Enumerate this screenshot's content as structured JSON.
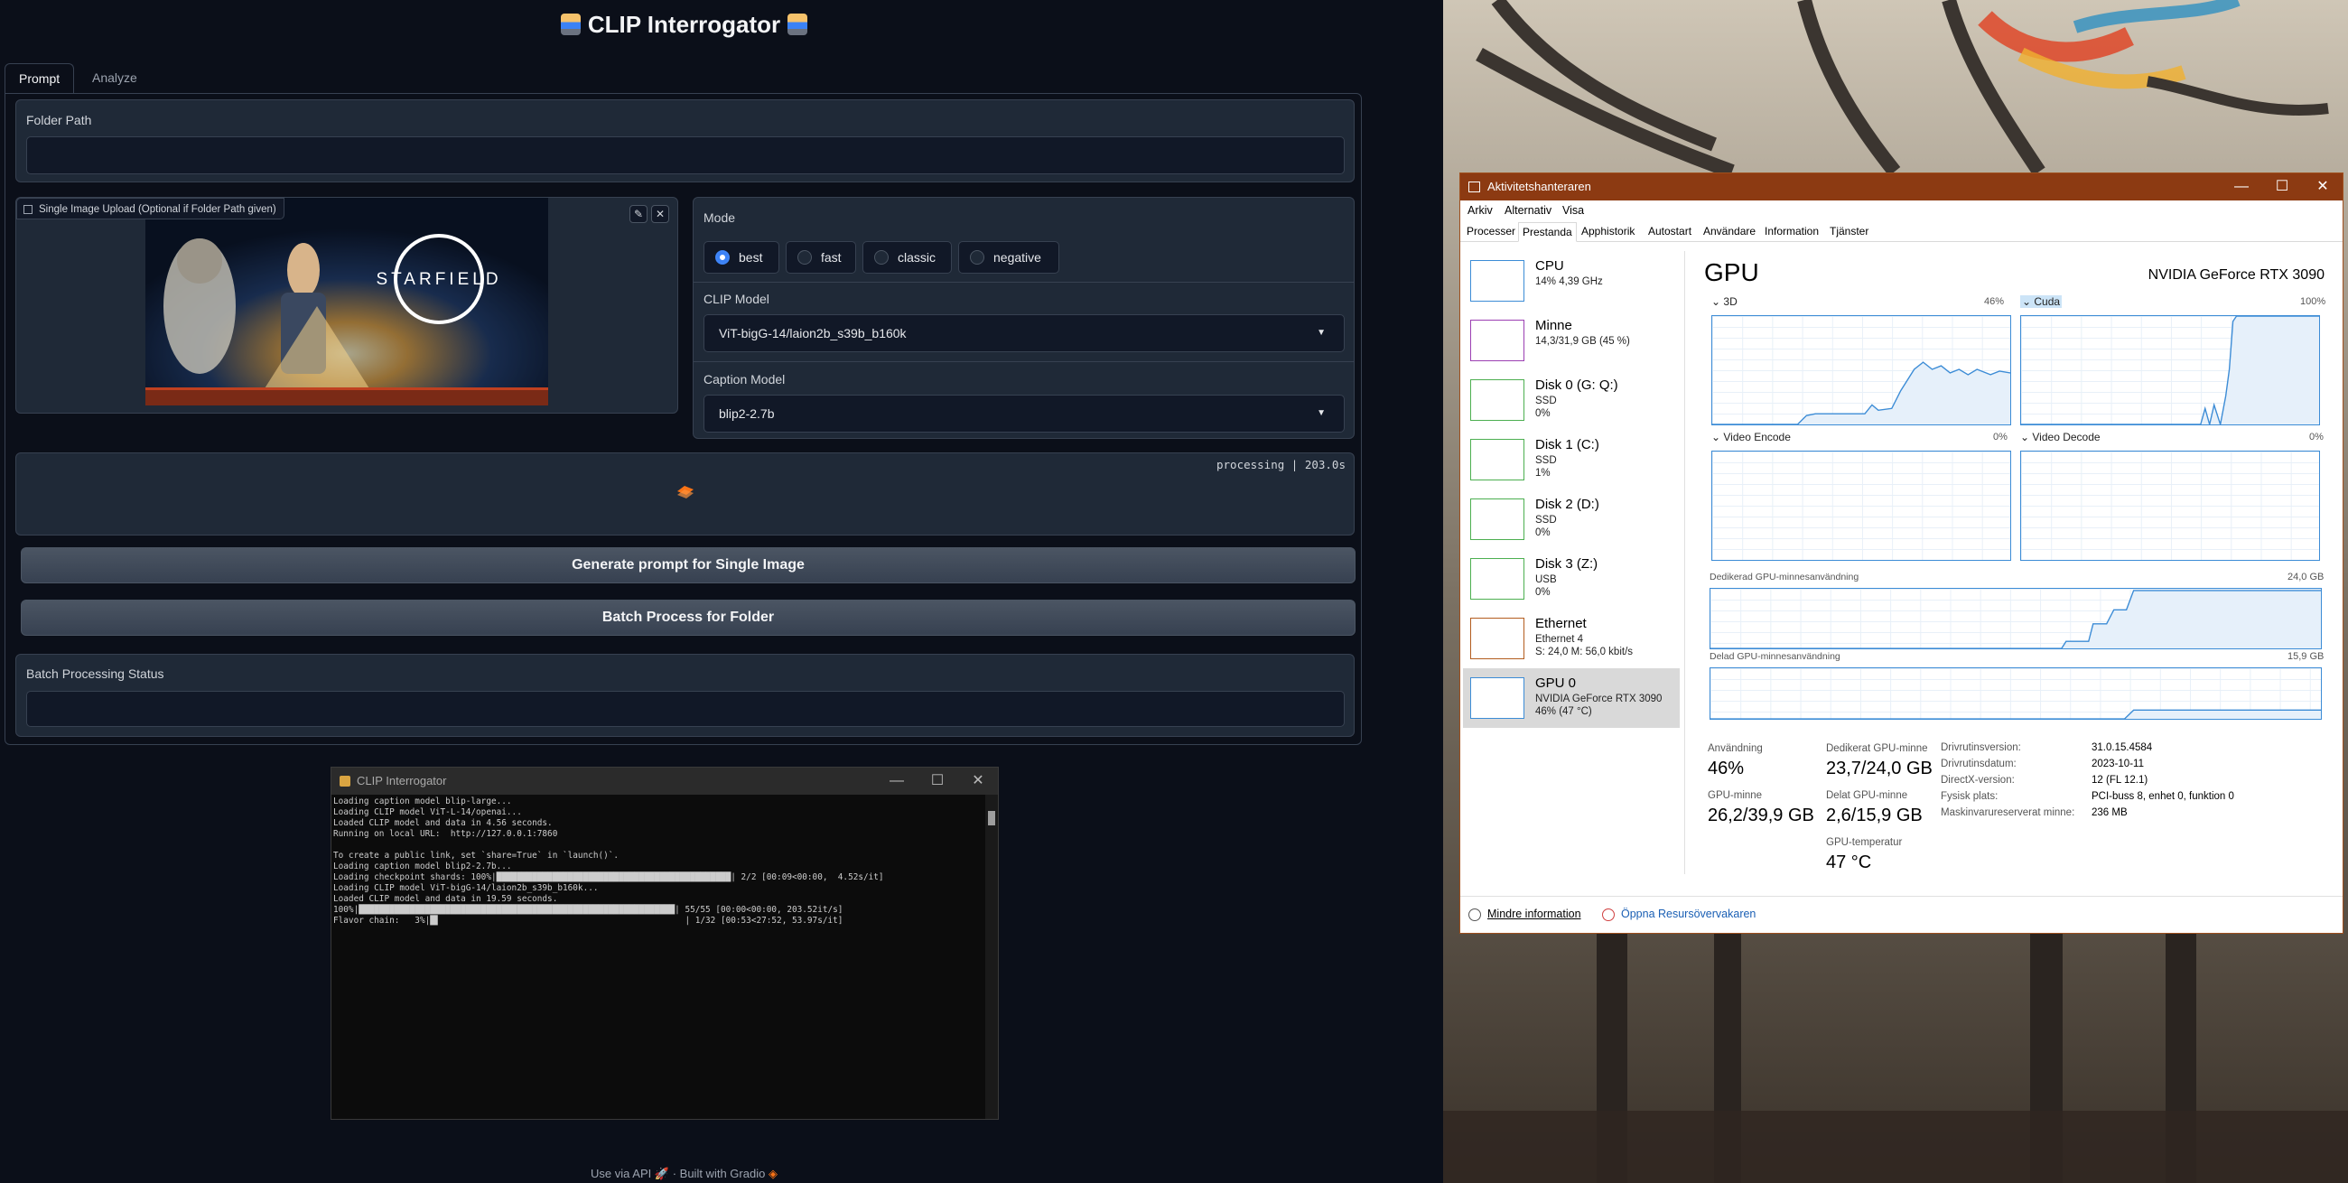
{
  "app": {
    "title": "CLIP Interrogator",
    "tabs": [
      "Prompt",
      "Analyze"
    ],
    "folder_path": {
      "label": "Folder Path",
      "value": ""
    },
    "image_upload": {
      "label": "Single Image Upload (Optional if Folder Path given)",
      "image_text": "STARFIELD"
    },
    "mode": {
      "label": "Mode",
      "options": [
        "best",
        "fast",
        "classic",
        "negative"
      ],
      "selected": "best"
    },
    "clip_model": {
      "label": "CLIP Model",
      "value": "ViT-bigG-14/laion2b_s39b_b160k"
    },
    "caption_model": {
      "label": "Caption Model",
      "value": "blip2-2.7b"
    },
    "output": {
      "status": "processing | 203.0s"
    },
    "buttons": {
      "generate": "Generate prompt for Single Image",
      "batch": "Batch Process for Folder"
    },
    "batch_status": {
      "label": "Batch Processing Status",
      "value": ""
    },
    "footer": {
      "api": "Use via API",
      "sep": "·",
      "built": "Built with Gradio"
    }
  },
  "console": {
    "title": "CLIP Interrogator",
    "lines": [
      "Loading caption model blip-large...",
      "Loading CLIP model ViT-L-14/openai...",
      "Loaded CLIP model and data in 4.56 seconds.",
      "Running on local URL:  http://127.0.0.1:7860",
      "",
      "To create a public link, set `share=True` in `launch()`.",
      "Loading caption model blip2-2.7b...",
      "Loading checkpoint shards: 100%|██████████████████████████████████████████████| 2/2 [00:09<00:00,  4.52s/it]",
      "Loading CLIP model ViT-bigG-14/laion2b_s39b_b160k...",
      "Loaded CLIP model and data in 19.59 seconds.",
      "100%|██████████████████████████████████████████████████████████████| 55/55 [00:00<00:00, 203.52it/s]",
      "Flavor chain:   3%|█▌                                                | 1/32 [00:53<27:52, 53.97s/it]"
    ]
  },
  "taskmgr": {
    "title": "Aktivitetshanteraren",
    "menu": [
      "Arkiv",
      "Alternativ",
      "Visa"
    ],
    "tabs": [
      "Processer",
      "Prestanda",
      "Apphistorik",
      "Autostart",
      "Användare",
      "Information",
      "Tjänster"
    ],
    "active_tab": "Prestanda",
    "side": [
      {
        "name": "CPU",
        "sub": [
          "14% 4,39 GHz"
        ]
      },
      {
        "name": "Minne",
        "sub": [
          "14,3/31,9 GB (45 %)"
        ]
      },
      {
        "name": "Disk 0 (G: Q:)",
        "sub": [
          "SSD",
          "0%"
        ]
      },
      {
        "name": "Disk 1 (C:)",
        "sub": [
          "SSD",
          "1%"
        ]
      },
      {
        "name": "Disk 2 (D:)",
        "sub": [
          "SSD",
          "0%"
        ]
      },
      {
        "name": "Disk 3 (Z:)",
        "sub": [
          "USB",
          "0%"
        ]
      },
      {
        "name": "Ethernet",
        "sub": [
          "Ethernet 4",
          "S: 24,0  M: 56,0 kbit/s"
        ]
      },
      {
        "name": "GPU 0",
        "sub": [
          "NVIDIA GeForce RTX 3090",
          "46% (47 °C)"
        ]
      }
    ],
    "gpu": {
      "title": "GPU",
      "model": "NVIDIA GeForce RTX 3090",
      "engines": [
        {
          "name": "3D",
          "pct": "46%"
        },
        {
          "name": "Cuda",
          "pct": "100%"
        },
        {
          "name": "Video Encode",
          "pct": "0%"
        },
        {
          "name": "Video Decode",
          "pct": "0%"
        }
      ],
      "dedicated_label": "Dedikerad GPU-minnesanvändning",
      "dedicated_max": "24,0 GB",
      "shared_label": "Delad GPU-minnesanvändning",
      "shared_max": "15,9 GB",
      "stats": {
        "usage_label": "Användning",
        "usage": "46%",
        "gpumem_label": "GPU-minne",
        "gpumem": "26,2/39,9 GB",
        "ded_label": "Dedikerat GPU-minne",
        "ded": "23,7/24,0 GB",
        "shared_label": "Delat GPU-minne",
        "shared": "2,6/15,9 GB",
        "temp_label": "GPU-temperatur",
        "temp": "47 °C"
      },
      "info": [
        {
          "k": "Drivrutinsversion:",
          "v": "31.0.15.4584"
        },
        {
          "k": "Drivrutinsdatum:",
          "v": "2023-10-11"
        },
        {
          "k": "DirectX-version:",
          "v": "12 (FL 12.1)"
        },
        {
          "k": "Fysisk plats:",
          "v": "PCI-buss 8, enhet 0, funktion 0"
        },
        {
          "k": "Maskinvarureserverat minne:",
          "v": "236 MB"
        }
      ]
    },
    "bottom": {
      "less": "Mindre information",
      "resmon": "Öppna Resursövervakaren"
    }
  },
  "colors": {
    "accent": "#3b82f6",
    "tm_titlebar": "#8c3a12",
    "graph_line": "#3c8cd6"
  }
}
